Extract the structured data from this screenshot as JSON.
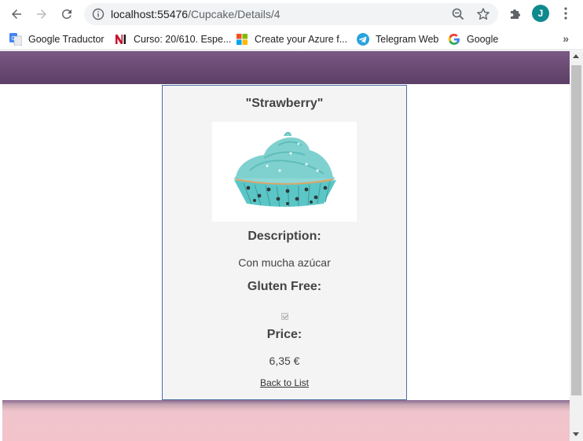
{
  "browser": {
    "url_host": "localhost:55476",
    "url_path": "/Cupcake/Details/4",
    "avatar_letter": "J"
  },
  "bookmarks": [
    {
      "label": "Google Traductor",
      "icon": "google-translate-icon"
    },
    {
      "label": "Curso: 20/610. Espe...",
      "icon": "ni-icon"
    },
    {
      "label": "Create your Azure f...",
      "icon": "microsoft-icon"
    },
    {
      "label": "Telegram Web",
      "icon": "telegram-icon"
    },
    {
      "label": "Google",
      "icon": "google-icon"
    }
  ],
  "bookmarks_more": "»",
  "details": {
    "name": "\"Strawberry\"",
    "description_label": "Description:",
    "description_value": "Con mucha azúcar",
    "gluten_label": "Gluten Free:",
    "gluten_free": true,
    "price_label": "Price:",
    "price_value": "6,35 €",
    "back_link": "Back to List"
  },
  "colors": {
    "header_purple": "#6a4a73",
    "footer_pink": "#f3c3cb",
    "card_border": "#4a6fa5",
    "avatar": "#0e8a8f"
  }
}
